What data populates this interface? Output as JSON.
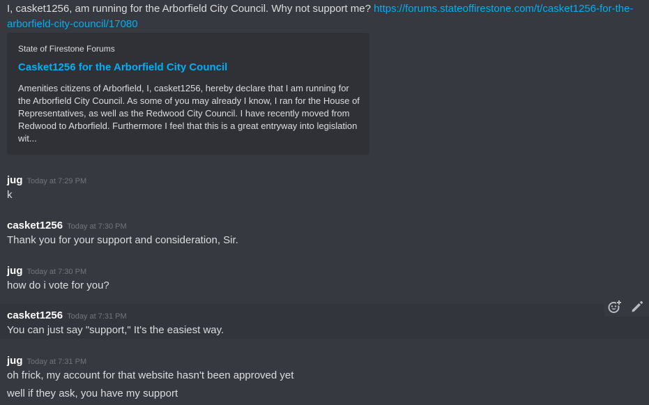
{
  "first_message": {
    "text": "I, casket1256, am running for the Arborfield City Council. Why not support me? ",
    "link": "https://forums.stateoffirestone.com/t/casket1256-for-the-arborfield-city-council/17080"
  },
  "embed": {
    "provider": "State of Firestone Forums",
    "title": "Casket1256 for the Arborfield City Council",
    "description": "Amenities citizens of Arborfield, I, casket1256, hereby declare that I am running for the Arborfield City Council. As some of you may already I know, I ran for the House of Representatives, as well as the Redwood City Council. I have recently moved from Redwood to Arborfield. Furthermore I feel that this is a great entryway into legislation wit..."
  },
  "messages": [
    {
      "author": "jug",
      "time": "Today at 7:29 PM",
      "lines": [
        "k"
      ]
    },
    {
      "author": "casket1256",
      "time": "Today at 7:30 PM",
      "lines": [
        "Thank you for your support and consideration, Sir."
      ]
    },
    {
      "author": "jug",
      "time": "Today at 7:30 PM",
      "lines": [
        "how do i vote for you?"
      ]
    },
    {
      "author": "casket1256",
      "time": "Today at 7:31 PM",
      "lines": [
        "You can just say \"support,\" It's the easiest way."
      ]
    },
    {
      "author": "jug",
      "time": "Today at 7:31 PM",
      "lines": [
        "oh frick, my account for that website hasn't been approved yet",
        "well if they ask, you have my support"
      ]
    }
  ],
  "actions": {
    "add_reaction_icon": "add-reaction-icon",
    "edit_icon": "pencil-icon"
  },
  "colors": {
    "background": "#36393f",
    "embed_background": "#2f3136",
    "link": "#00b0f4",
    "text": "#dcddde",
    "username": "#ffffff",
    "timestamp": "#72767d"
  }
}
